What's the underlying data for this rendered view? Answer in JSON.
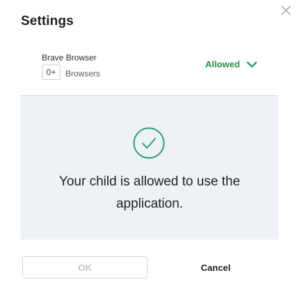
{
  "dialog": {
    "title": "Settings",
    "close_icon": "close-icon"
  },
  "app": {
    "name": "Brave Browser",
    "age_rating": "0+",
    "category": "Browsers",
    "status": "Allowed",
    "status_icon": "chevron-down-icon",
    "status_color": "#2f8a3e"
  },
  "message": {
    "icon": "check-circle-icon",
    "text": "Your child is allowed to use the application.",
    "icon_color": "#2aa276",
    "panel_color": "#eef2f6"
  },
  "actions": {
    "ok_label": "OK",
    "cancel_label": "Cancel"
  }
}
